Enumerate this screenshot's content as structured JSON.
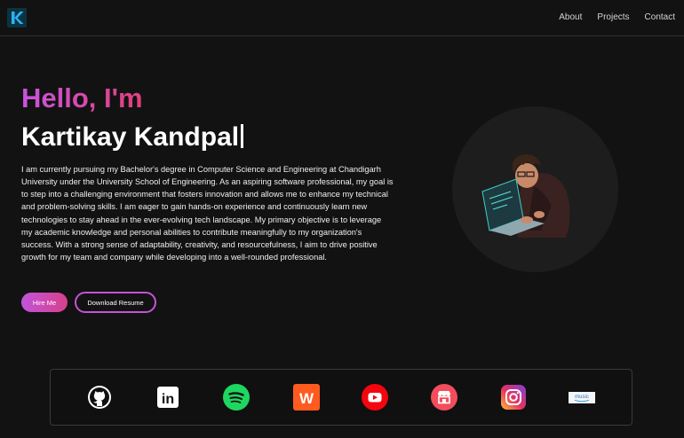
{
  "header": {
    "logo_letter": "K",
    "nav": [
      "About",
      "Projects",
      "Contact"
    ]
  },
  "hero": {
    "greeting": "Hello, I'm",
    "name": "Kartikay Kandpal",
    "bio": "I am currently pursuing my Bachelor's degree in Computer Science and Engineering at Chandigarh University under the University School of Engineering. As an aspiring software professional, my goal is to step into a challenging environment that fosters innovation and allows me to enhance my technical and problem-solving skills. I am eager to gain hands-on experience and continuously learn new technologies to stay ahead in the ever-evolving tech landscape. My primary objective is to leverage my academic knowledge and personal abilities to contribute meaningfully to my organization's success. With a strong sense of adaptability, creativity, and resourcefulness, I aim to drive positive growth for my team and company while developing into a well-rounded professional.",
    "hire_label": "Hire Me",
    "resume_label": "Download Resume"
  },
  "social": {
    "icons": [
      "github-icon",
      "linkedin-icon",
      "spotify-icon",
      "wattpad-icon",
      "youtube-icon",
      "store-icon",
      "instagram-icon",
      "amazon-music-icon"
    ],
    "linkedin_text": "in",
    "wattpad_text": "W",
    "amazon_music_text": "music"
  },
  "colors": {
    "background": "#121212",
    "accent_start": "#c855e0",
    "accent_end": "#e0407a"
  }
}
